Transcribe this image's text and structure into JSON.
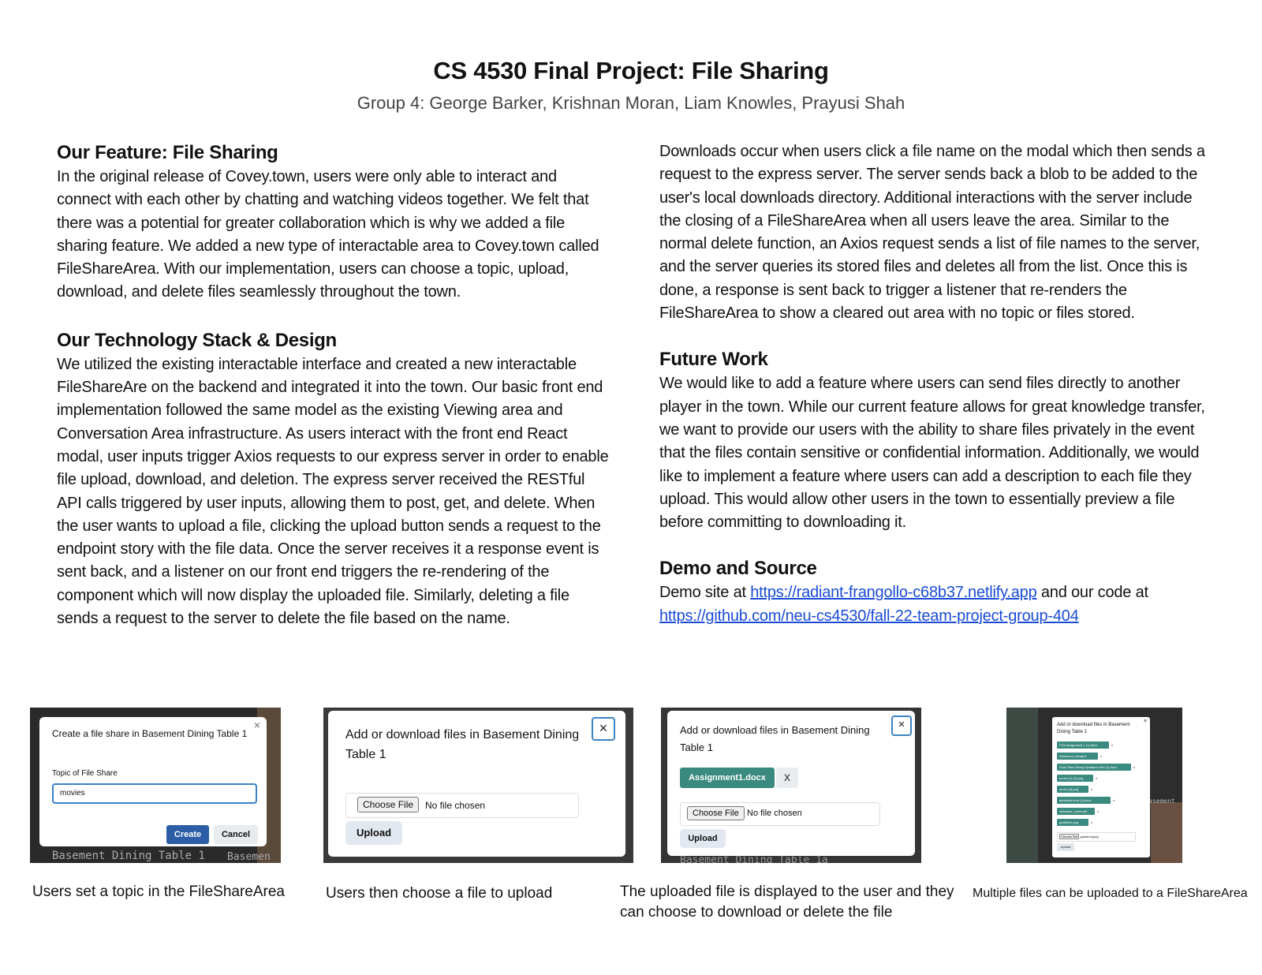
{
  "header": {
    "title": "CS 4530 Final Project: File Sharing",
    "subtitle": "Group 4: George Barker, Krishnan Moran, Liam Knowles, Prayusi Shah"
  },
  "left": {
    "feature_heading": "Our Feature: File Sharing",
    "feature_text": "In the original release of Covey.town, users were only able to interact and connect with each other by chatting and watching videos together. We felt that there was a potential for greater collaboration which is why we added a file sharing feature. We added a new type of interactable area to Covey.town called FileShareArea. With our implementation, users can choose a topic, upload, download, and delete files seamlessly throughout the town.",
    "stack_heading": "Our Technology Stack & Design",
    "stack_text": "We utilized the existing interactable interface and created a new interactable FileShareAre on the backend and integrated it into the town. Our basic front end implementation followed the same model as the existing Viewing area and Conversation Area infrastructure. As users interact with the front end React modal, user inputs trigger Axios requests to our express server in order to enable file upload, download, and deletion. The express server received the RESTful API calls triggered by user inputs, allowing them to post, get, and delete. When the user wants to upload a file, clicking the upload button sends a request to the endpoint story with the file data. Once the server receives it a response event is sent back, and a listener on our front end triggers the re-rendering of the component which will now display the uploaded file. Similarly, deleting a file sends a request to the server to delete the file based on the name."
  },
  "right": {
    "downloads_text": "Downloads occur when users click a file name on the modal which then sends a request to the express server. The server sends back a blob to be added to the user's local downloads directory. Additional interactions with the server include the closing of a FileShareArea when all users leave the area. Similar to the normal delete function, an Axios request sends a list of file names to the server, and the server queries its stored files and deletes all from the list. Once this is done, a response is sent back to trigger a listener that re-renders the FileShareArea to show a cleared out area with no topic or files stored.",
    "future_heading": "Future Work",
    "future_text": "We would like to add a feature where users can send files directly to another player in the town. While our current feature allows for great knowledge transfer, we want to provide our users with the ability to share files privately in the event that the files contain sensitive or confidential information. Additionally, we would like to implement a feature where users can add a description to each file they upload. This would allow other users in the town to essentially preview a file before committing to downloading it.",
    "demo_heading": "Demo and Source",
    "demo_prefix": "Demo site at",
    "demo_link": "https://radiant-frangollo-c68b37.netlify.app",
    "demo_middle": " and our code at",
    "code_link": "https://github.com/neu-cs4530/fall-22-team-project-group-404"
  },
  "screenshots": {
    "shot1": {
      "modal_title": "Create a file share in Basement Dining Table 1",
      "field_label": "Topic of File Share",
      "field_value": "movies",
      "create_label": "Create",
      "cancel_label": "Cancel",
      "bg_text": "Basement Dining Table 1",
      "bg_text2": "Basemen",
      "caption": "Users set a topic in the FileShareArea"
    },
    "shot2": {
      "modal_title": "Add or download files in Basement Dining Table 1",
      "choose_label": "Choose File",
      "no_file": "No file chosen",
      "upload_label": "Upload",
      "caption": "Users then choose a file to upload"
    },
    "shot3": {
      "modal_title": "Add or download files in Basement Dining Table 1",
      "file_name": "Assignment1.docx",
      "delete_label": "X",
      "choose_label": "Choose File",
      "no_file": "No file chosen",
      "upload_label": "Upload",
      "bg_text": "Basement Dining Table 1a",
      "caption": "The uploaded file is displayed to the user and they can choose to download or delete the file"
    },
    "shot4": {
      "modal_title": "Add or download files in Basement Dining Table 1",
      "files": [
        "CS3 assignment 1 (1).docx",
        "Advanced_Design1",
        "Final Team Essay Updated 4 6ld (1).docx",
        "errors (1) (1).png",
        "errors (4).png",
        "attributions.txt (1).docx",
        "character_notes.pdf",
        "gradients.png"
      ],
      "choose_label": "Choose File",
      "chosen": "gradient.jpeg",
      "upload_label": "Upload",
      "bg_text": "asement",
      "caption": "Multiple files can be uploaded to a FileShareArea"
    }
  },
  "colors": {
    "link": "#1a4bd6",
    "teal": "#3a8a80",
    "primary": "#2b6cb0"
  }
}
